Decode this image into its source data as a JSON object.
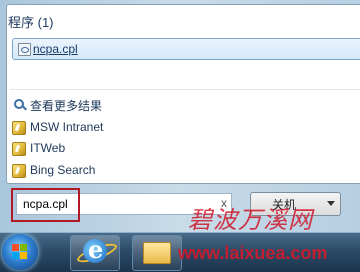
{
  "start_menu": {
    "section_title": "程序 (1)",
    "result": {
      "label": "ncpa.cpl",
      "icon": "control-panel-icon"
    },
    "links": [
      {
        "label": "查看更多结果",
        "icon": "search-icon"
      },
      {
        "label": "MSW Intranet",
        "icon": "network-link-icon"
      },
      {
        "label": "ITWeb",
        "icon": "network-link-icon"
      },
      {
        "label": "Bing Search",
        "icon": "network-link-icon"
      }
    ],
    "search_value": "ncpa.cpl",
    "clear_glyph": "x",
    "shutdown_label": "关机"
  },
  "watermark": {
    "chinese": "碧波万溪网",
    "url": "www.laixuea.com"
  },
  "colors": {
    "highlight_border": "#7da2ce",
    "outline_red": "#b11a25",
    "watermark_red": "#d41a2c"
  }
}
